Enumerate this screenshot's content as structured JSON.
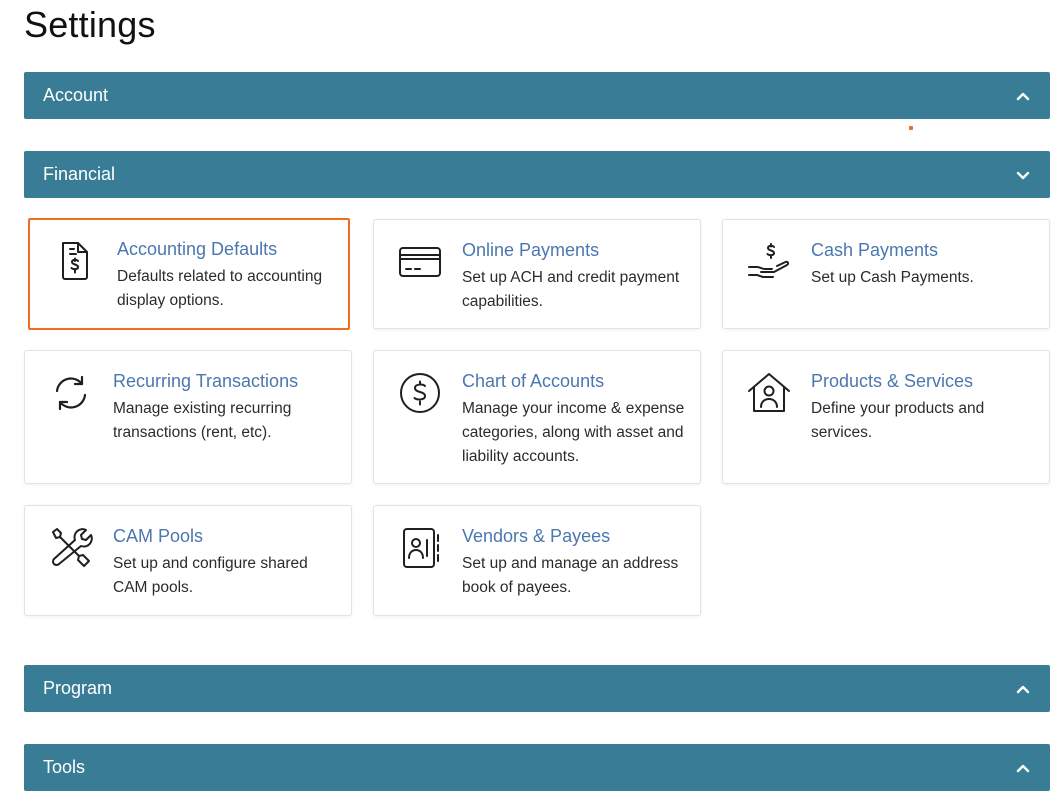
{
  "page": {
    "title": "Settings"
  },
  "sections": {
    "account": {
      "label": "Account",
      "state": "collapsed"
    },
    "financial": {
      "label": "Financial",
      "state": "expanded"
    },
    "program": {
      "label": "Program",
      "state": "collapsed"
    },
    "tools": {
      "label": "Tools",
      "state": "collapsed"
    }
  },
  "cards": [
    {
      "title": "Accounting Defaults",
      "desc": "Defaults related to accounting display options.",
      "icon": "document-dollar-icon",
      "selected": true
    },
    {
      "title": "Online Payments",
      "desc": "Set up ACH and credit payment capabilities.",
      "icon": "credit-card-icon",
      "selected": false
    },
    {
      "title": "Cash Payments",
      "desc": "Set up Cash Payments.",
      "icon": "hand-dollar-icon",
      "selected": false
    },
    {
      "title": "Recurring Transactions",
      "desc": "Manage existing recurring transactions (rent, etc).",
      "icon": "refresh-icon",
      "selected": false
    },
    {
      "title": "Chart of Accounts",
      "desc": "Manage your income & expense categories, along with asset and liability accounts.",
      "icon": "dollar-circle-icon",
      "selected": false
    },
    {
      "title": "Products & Services",
      "desc": "Define your products and services.",
      "icon": "house-person-icon",
      "selected": false
    },
    {
      "title": "CAM Pools",
      "desc": "Set up and configure shared CAM pools.",
      "icon": "tools-icon",
      "selected": false
    },
    {
      "title": "Vendors & Payees",
      "desc": "Set up and manage an address book of payees.",
      "icon": "address-book-icon",
      "selected": false
    }
  ],
  "colors": {
    "header_bg": "#387d95",
    "card_title": "#4b77b0",
    "selected_border": "#f26b21"
  }
}
